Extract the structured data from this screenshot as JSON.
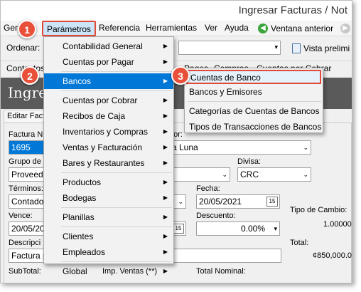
{
  "window": {
    "title": "Ingresar Facturas / Not"
  },
  "menubar": {
    "general": "General",
    "parametros": "Parámetros",
    "referencia": "Referencia",
    "herramientas": "Herramientas",
    "ver": "Ver",
    "ayuda": "Ayuda",
    "ventana_anterior": "Ventana anterior"
  },
  "toolbar": {
    "ordenar_label": "Ordenar:",
    "vista_previa": "Vista prelimi",
    "contactos": "Contactos",
    "pages_fragment": "Pages",
    "compras_fragment": "Compras",
    "cuentas_cobrar_fragment": "Cuentas por Cobrar"
  },
  "header": {
    "big_title": "Ingres"
  },
  "tab": {
    "label": "Editar Factu"
  },
  "form": {
    "factura_label": "Factura N",
    "factura_value": "1695",
    "proveedor_label": "dor:",
    "proveedor_value": "a Luna",
    "grupo_label": "Grupo de",
    "grupo_value": "Proveedo",
    "divisa_label": "Divisa:",
    "divisa_value": "CRC",
    "terminos_label": "Términos:",
    "terminos_value": "Contado",
    "fecha_label": "Fecha:",
    "fecha_value": "20/05/2021",
    "vence_label": "Vence:",
    "vence_value": "20/05/20",
    "descuento_label": "Descuento:",
    "descuento_value": "0.00%",
    "tipo_cambio_label": "Tipo de Cambio:",
    "tipo_cambio_value": "1.00000",
    "descripcion_label": "Descripci",
    "descripcion_value": "Factura p",
    "total_label": "Total:",
    "total_value": "¢850,000.0",
    "subtotal_label": "SubTotal:",
    "imp_ventas_label": "Imp. Ventas (**)",
    "total_nominal_label": "Total Nominal:"
  },
  "parametros_menu": [
    {
      "label": "Contabilidad General"
    },
    {
      "label": "Cuentas por Pagar"
    },
    {
      "label": "Bancos"
    },
    {
      "label": "Cuentas por Cobrar"
    },
    {
      "label": "Recibos de Caja"
    },
    {
      "label": "Inventarios y Compras"
    },
    {
      "label": "Ventas y Facturación"
    },
    {
      "label": "Bares y Restaurantes"
    },
    {
      "label": "Productos"
    },
    {
      "label": "Bodegas"
    },
    {
      "label": "Planillas"
    },
    {
      "label": "Clientes"
    },
    {
      "label": "Empleados"
    },
    {
      "label": "Global"
    }
  ],
  "bancos_submenu": [
    {
      "label": "Cuentas de Banco"
    },
    {
      "label": "Bancos y Emisores"
    },
    {
      "label": "Categorías de Cuentas de Bancos"
    },
    {
      "label": "Tipos de Transacciones de Bancos"
    }
  ],
  "badges": {
    "one": "1",
    "two": "2",
    "three": "3"
  },
  "colors": {
    "highlight": "#0078d7",
    "annotation": "#e8503a",
    "header_band": "#5a5a5a"
  }
}
